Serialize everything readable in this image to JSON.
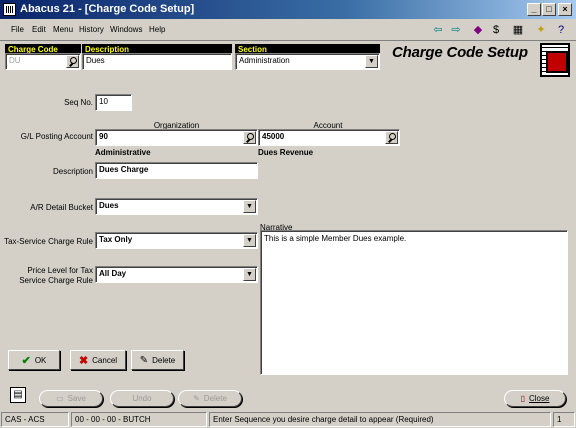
{
  "window": {
    "title": "Abacus 21 - [Charge Code Setup]"
  },
  "menu": [
    "File",
    "Edit",
    "Menu",
    "History",
    "Windows",
    "Help"
  ],
  "header": {
    "charge_code_label": "Charge Code",
    "charge_code_value": "DU",
    "description_label": "Description",
    "description_value": "Dues",
    "section_label": "Section",
    "section_value": "Administration",
    "form_title": "Charge Code Setup"
  },
  "form": {
    "seq_label": "Seq No.",
    "seq_value": "10",
    "organization_caption": "Organization",
    "account_caption": "Account",
    "gl_label": "G/L Posting Account",
    "gl_org_value": "90",
    "gl_account_value": "45000",
    "org_name": "Administrative",
    "account_name": "Dues Revenue",
    "description_label": "Description",
    "description_value": "Dues Charge",
    "ar_label": "A/R Detail Bucket",
    "ar_value": "Dues",
    "tax_rule_label": "Tax-Service Charge Rule",
    "tax_rule_value": "Tax Only",
    "price_level_label_1": "Price Level for Tax",
    "price_level_label_2": "Service Charge Rule",
    "price_level_value": "All Day",
    "narrative_label": "Narrative",
    "narrative_text": "This is a simple Member Dues example."
  },
  "buttons": {
    "ok": "OK",
    "cancel": "Cancel",
    "delete": "Delete",
    "save": "Save",
    "undo": "Undo",
    "delete2": "Delete",
    "close": "Close"
  },
  "status": {
    "company": "CAS - ACS",
    "user": "00 - 00 - 00 - BUTCH",
    "hint": "Enter Sequence you desire charge detail to appear (Required)",
    "page": "1"
  },
  "icons": {
    "toolbar": [
      "arrow-left-icon",
      "arrow-right-icon",
      "books-icon",
      "dollar-icon",
      "calculator-icon",
      "runner-icon",
      "help-icon"
    ]
  }
}
